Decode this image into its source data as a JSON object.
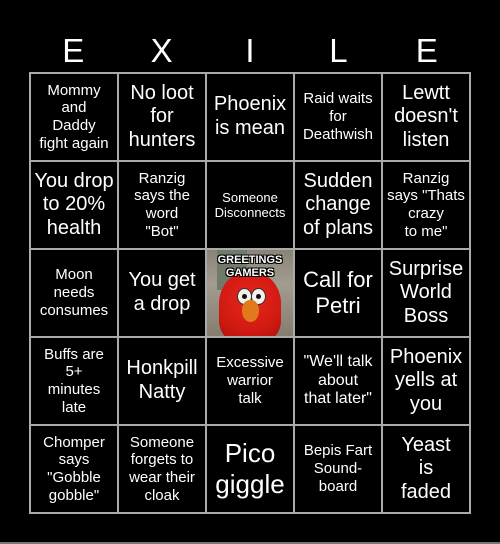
{
  "header": {
    "letters": [
      "E",
      "X",
      "I",
      "L",
      "E"
    ]
  },
  "board": {
    "cells": [
      [
        "Mommy\nand\nDaddy\nfight again",
        "No loot\nfor\nhunters",
        "Phoenix\nis mean",
        "Raid waits\nfor\nDeathwish",
        "Lewtt\ndoesn't\nlisten"
      ],
      [
        "You drop\nto 20%\nhealth",
        "Ranzig\nsays the\nword\n\"Bot\"",
        "Someone\nDisconnects",
        "Sudden\nchange\nof plans",
        "Ranzig\nsays \"Thats\ncrazy\nto me\""
      ],
      [
        "Moon\nneeds\nconsumes",
        "You get\na drop",
        "",
        "Call for\nPetri",
        "Surprise\nWorld\nBoss"
      ],
      [
        "Buffs are\n5+\nminutes\nlate",
        "Honkpill\nNatty",
        "Excessive\nwarrior\ntalk",
        "\"We'll talk\nabout\nthat later\"",
        "Phoenix\nyells at\nyou"
      ],
      [
        "Chomper\nsays\n\"Gobble\ngobble\"",
        "Someone\nforgets to\nwear their\ncloak",
        "Pico\ngiggle",
        "Bepis Fart\nSound-\nboard",
        "Yeast\nis\nfaded"
      ]
    ],
    "free_space": {
      "image": "elmo-greetings-gamers",
      "caption": "GREETINGS\nGAMERS"
    }
  },
  "colors": {
    "background": "#000000",
    "text": "#ffffff",
    "grid_line": "#aaaaaa"
  }
}
